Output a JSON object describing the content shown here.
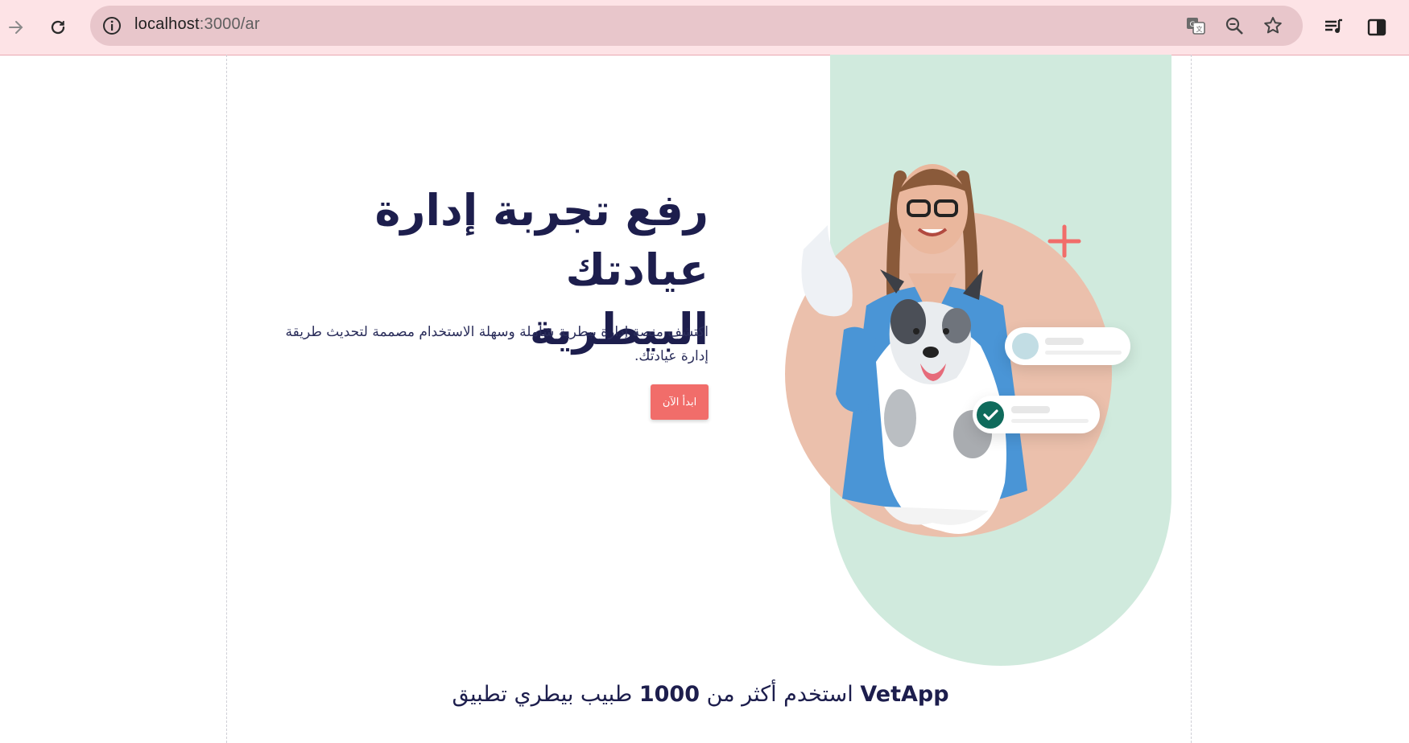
{
  "browser": {
    "url_host": "localhost",
    "url_path": ":3000/ar",
    "icons": [
      "forward-icon",
      "reload-icon",
      "site-info-icon",
      "translate-icon",
      "zoom-out-icon",
      "bookmark-star-icon",
      "reading-list-icon",
      "side-panel-icon"
    ]
  },
  "hero": {
    "title_line1": "رفع تجربة إدارة عيادتك",
    "title_line2": "البيطرية",
    "subtitle": "اكتشف منصة إدارة بيطرية شاملة وسهلة الاستخدام مصممة لتحديث طريقة إدارة عيادتك.",
    "cta_label": "ابدأ الآن"
  },
  "trust": {
    "prefix": "VetApp",
    "middle": "استخدم أكثر من",
    "count": "1000",
    "suffix": "طبيب بيطري تطبيق"
  },
  "colors": {
    "accent": "#f16d6a",
    "navy": "#1d1e4d",
    "mint": "#d0eadd",
    "peach": "#ebc0ac",
    "check": "#0f6b5c"
  }
}
